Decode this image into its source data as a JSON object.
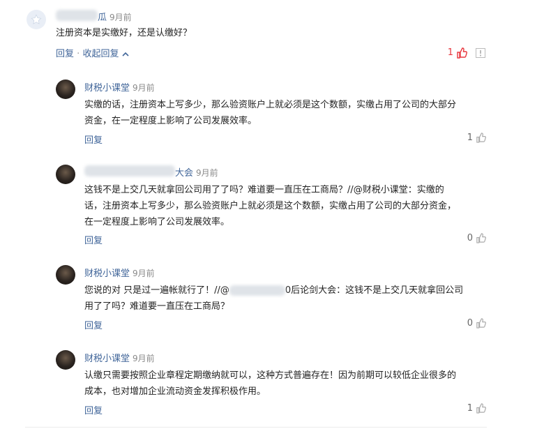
{
  "top_comment": {
    "author_suffix": "瓜",
    "time": "9月前",
    "text": "注册资本是实缴好，还是认缴好？",
    "reply_label": "回复",
    "separator": "·",
    "collapse_label": "收起回复",
    "likes": "1",
    "like_color": "#e8373e"
  },
  "replies": [
    {
      "author": "财税小课堂",
      "time": "9月前",
      "lines": [
        "实缴的话，注册资本上写多少，那么验资账户上就必须是这个数额，实缴占用了公司的大部分",
        "资金，在一定程度上影响了公司发展效率。"
      ],
      "reply_label": "回复",
      "likes": "1"
    },
    {
      "author_suffix": "大会",
      "time": "9月前",
      "lines": [
        "这钱不是上交几天就拿回公司用了了吗？难道要一直压在工商局？//@财税小课堂：实缴的",
        "话，注册资本上写多少，那么验资账户上就必须是这个数额，实缴占用了公司的大部分资金，",
        "在一定程度上影响了公司发展效率。"
      ],
      "reply_label": "回复",
      "likes": "0"
    },
    {
      "author": "财税小课堂",
      "time": "9月前",
      "line1_prefix": "您说的对 只是过一遍帐就行了！//@",
      "line1_suffix": "0后论剑大会：这钱不是上交几天就拿回公司",
      "line2": "用了了吗？难道要一直压在工商局？",
      "reply_label": "回复",
      "likes": "0"
    },
    {
      "author": "财税小课堂",
      "time": "9月前",
      "lines": [
        "认缴只需要按照企业章程定期缴纳就可以，这种方式普遍存在！因为前期可以较低企业很多的",
        "成本，也对增加企业流动资金发挥积极作用。"
      ],
      "reply_label": "回复",
      "likes": "1"
    }
  ]
}
